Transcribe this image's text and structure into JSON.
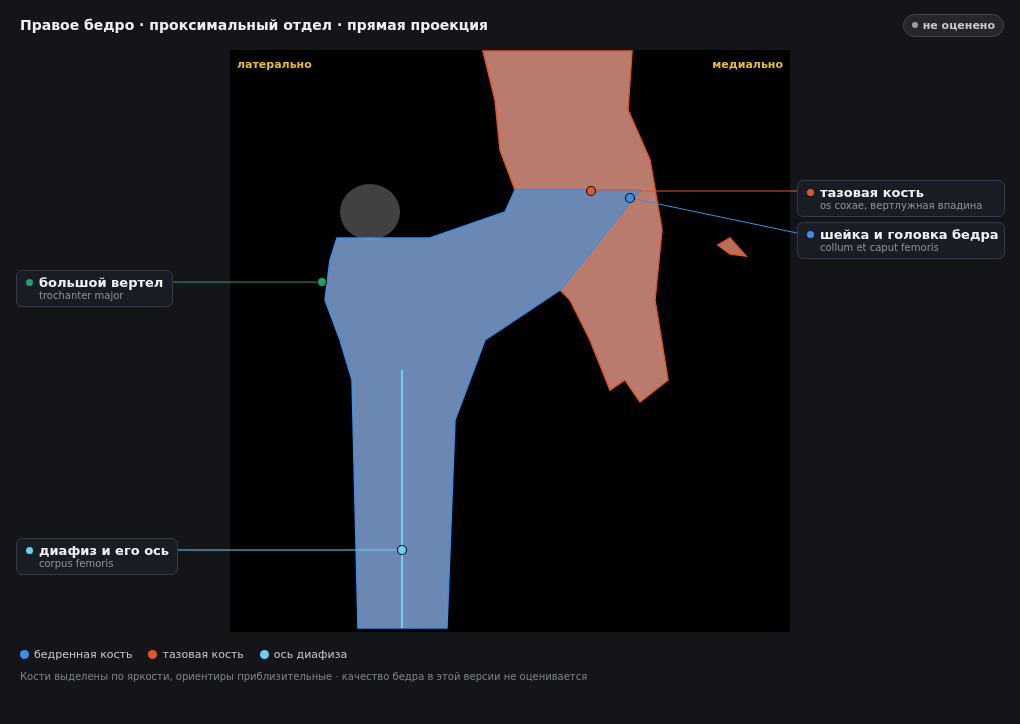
{
  "title": "Правое бедро · проксимальный отдел · прямая проекция",
  "badge": {
    "label": "не оценено"
  },
  "image": {
    "lateral_label": "латерально",
    "medial_label": "медиально"
  },
  "callouts": [
    {
      "title": "тазовая кость",
      "subtitle": "os coxae, вертлужная впадина",
      "color": "#e0582a"
    },
    {
      "title": "шейка и головка бедра",
      "subtitle": "collum et caput femoris",
      "color": "#3b8fe8"
    },
    {
      "title": "большой вертел",
      "subtitle": "trochanter major",
      "color": "#22a06b"
    },
    {
      "title": "диафиз и его ось",
      "subtitle": "corpus femoris",
      "color": "#6cd0f5"
    }
  ],
  "legend": [
    {
      "label": "бедренная кость",
      "color": "#3b8fe8"
    },
    {
      "label": "тазовая кость",
      "color": "#e0582a"
    },
    {
      "label": "ось диафиза",
      "color": "#6cd0f5"
    }
  ],
  "footnote": "Кости выделены по яркости, ориентиры приблизительные · качество бедра в этой версии не оценивается"
}
